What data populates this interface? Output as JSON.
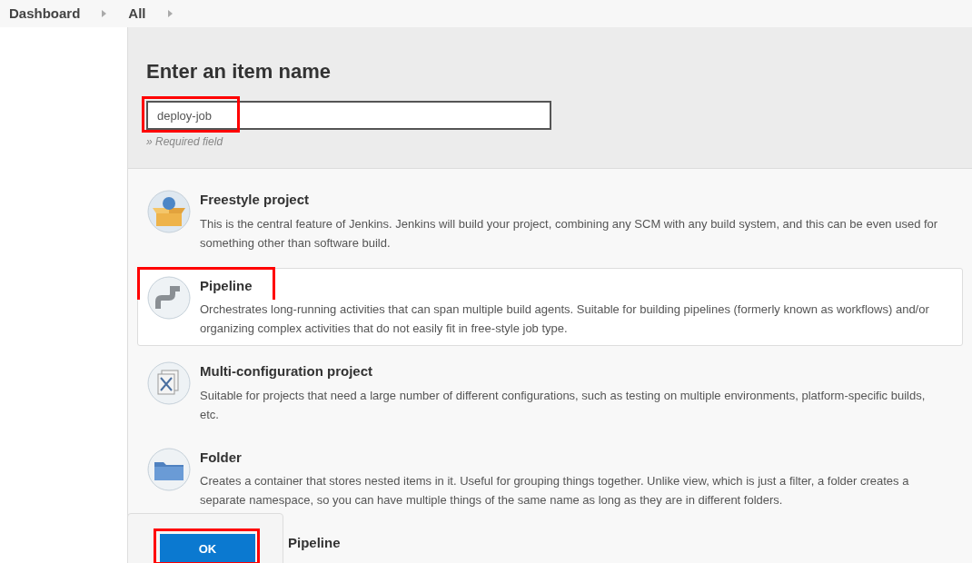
{
  "breadcrumbs": [
    {
      "label": "Dashboard"
    },
    {
      "label": "All"
    }
  ],
  "heading": "Enter an item name",
  "name_field": {
    "value": "deploy-job",
    "hint": "» Required field"
  },
  "item_types": [
    {
      "kind": "freestyle",
      "title": "Freestyle project",
      "description": "This is the central feature of Jenkins. Jenkins will build your project, combining any SCM with any build system, and this can be even used for something other than software build.",
      "selected": false
    },
    {
      "kind": "pipeline",
      "title": "Pipeline",
      "description": "Orchestrates long-running activities that can span multiple build agents. Suitable for building pipelines (formerly known as workflows) and/or organizing complex activities that do not easily fit in free-style job type.",
      "selected": true
    },
    {
      "kind": "multiconfig",
      "title": "Multi-configuration project",
      "description": "Suitable for projects that need a large number of different configurations, such as testing on multiple environments, platform-specific builds, etc.",
      "selected": false
    },
    {
      "kind": "folder",
      "title": "Folder",
      "description": "Creates a container that stores nested items in it. Useful for grouping things together. Unlike view, which is just a filter, a folder creates a separate namespace, so you can have multiple things of the same name as long as they are in different folders.",
      "selected": false
    },
    {
      "kind": "multibranch",
      "title": "Pipeline",
      "selected": false
    }
  ],
  "ok_button": {
    "label": "OK"
  }
}
